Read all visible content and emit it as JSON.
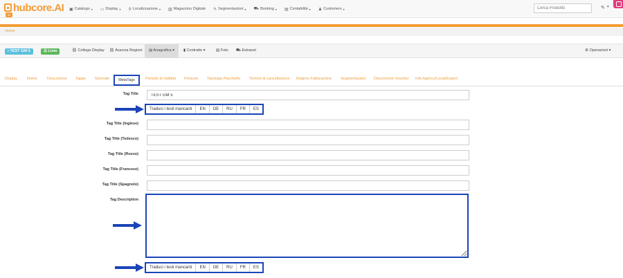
{
  "navbar": {
    "logo_text": "hubcore.AI",
    "logo_badge": "AI",
    "menu": [
      {
        "label": "Catalogo",
        "icon": "catalog-icon",
        "caret": true
      },
      {
        "label": "Display",
        "icon": "monitor-icon",
        "caret": true
      },
      {
        "label": "Localizzazione",
        "icon": "map-marker-icon",
        "caret": true
      },
      {
        "label": "Magazzino Digitale",
        "icon": "warehouse-icon",
        "caret": false
      },
      {
        "label": "Segmentazioni",
        "icon": "wrench-icon",
        "caret": true
      },
      {
        "label": "Booking",
        "icon": "cart-icon",
        "caret": true
      },
      {
        "label": "Contabilità",
        "icon": "ledger-icon",
        "caret": true
      },
      {
        "label": "Customers",
        "icon": "user-icon",
        "caret": true
      }
    ],
    "search_placeholder": "Cerca Prodotto"
  },
  "breadcrumb": {
    "home": "Home"
  },
  "toolbar": {
    "product_tag": "TEST GM 5",
    "list_tag": "Lista",
    "link_display": "Collega Display",
    "link_regions": "Associa Regioni",
    "anagrafica": "Anagrafica",
    "contratto": "Contratto",
    "foto": "Foto",
    "extranet": "Extranet",
    "operazioni": "Operazioni"
  },
  "tabs": {
    "items": [
      "Display",
      "Nome",
      "Descrizione",
      "Tappe",
      "Giornate",
      "MetaTags",
      "Periodo di Validità",
      "Persone",
      "Tipologia Pacchetto",
      "Termini di cancellazione",
      "Regime Fatturazione",
      "Segmentazioni",
      "Descrizione Voucher",
      "Info Agency/Local/Expert"
    ],
    "active": "MetaTags"
  },
  "form": {
    "tag_title_label": "Tag Title",
    "tag_title_value": "TEST GM 5",
    "tag_title_en_label": "Tag Title (Inglese)",
    "tag_title_de_label": "Tag Title (Tedesco)",
    "tag_title_ru_label": "Tag Title (Russo)",
    "tag_title_fr_label": "Tag Title (Francese)",
    "tag_title_es_label": "Tag Title (Spagnolo)",
    "tag_description_label": "Tag Description"
  },
  "translate": {
    "button_label": "Traduci i testi mancanti",
    "languages": [
      "EN",
      "DE",
      "RU",
      "FR",
      "ES"
    ]
  },
  "colors": {
    "accent": "#f39c35",
    "highlight": "#1a44b8",
    "info": "#5bc0de",
    "success": "#5cb85c"
  }
}
